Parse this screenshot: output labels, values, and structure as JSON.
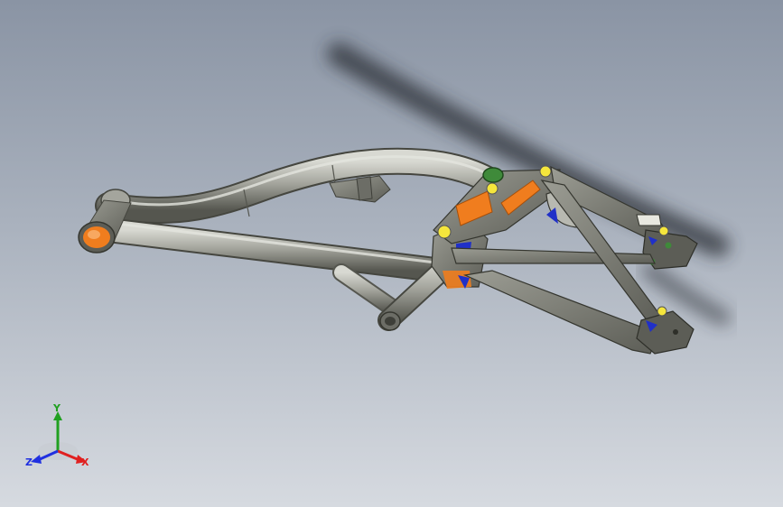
{
  "viewport": {
    "background_top": "#8a94a4",
    "background_bottom": "#d6dae0"
  },
  "model": {
    "frame_color": "#8f9088",
    "accent_orange": "#f07d1e",
    "accent_yellow": "#f5e63c",
    "accent_blue": "#2030c8",
    "accent_green": "#3f8a3a"
  },
  "triad": {
    "y_label": "Y",
    "x_label": "X",
    "z_label": "Z",
    "y_color": "#20a020",
    "x_color": "#e02020",
    "z_color": "#2030e0"
  }
}
